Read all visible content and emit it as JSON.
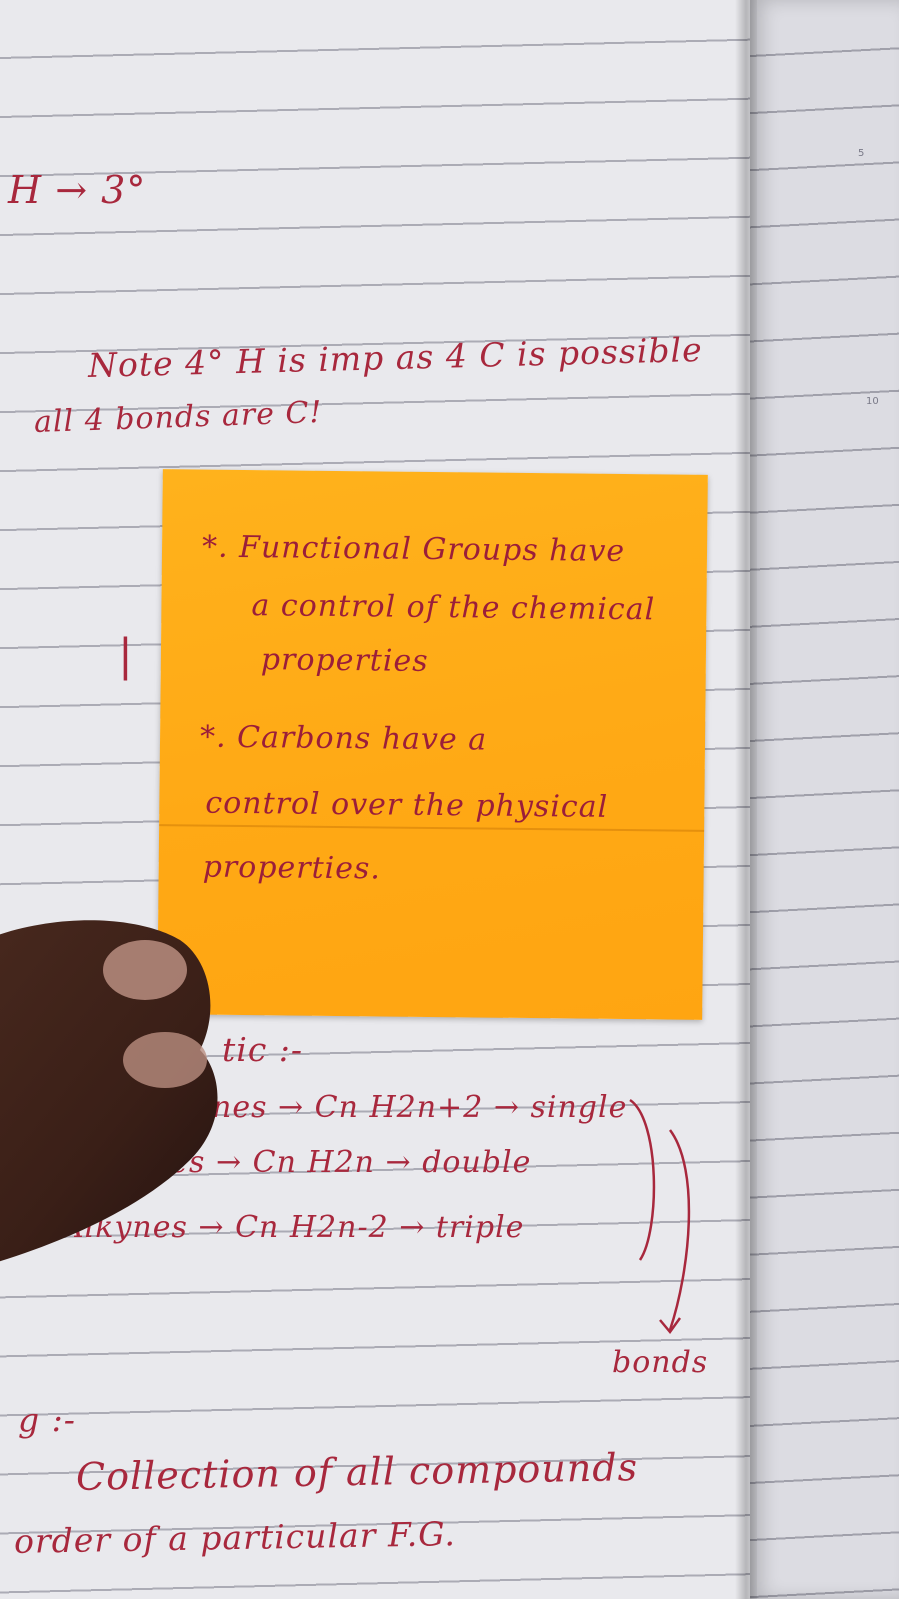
{
  "notebook": {
    "top_fragment": "H → 3°",
    "note_line_1": "Note 4° H is imp as 4 C is possible",
    "note_line_2": "all 4 bonds are C!",
    "margin_mark": "|",
    "page_numbers": [
      "5",
      "10"
    ]
  },
  "sticky_note": {
    "point_1_line_1": "*. Functional Groups have",
    "point_1_line_2": "a control of the chemical",
    "point_1_line_3": "properties",
    "point_2_line_1": "*. Carbons have a",
    "point_2_line_2": "control over the physical",
    "point_2_line_3": "properties."
  },
  "lower_notes": {
    "heading": "tic :-",
    "alkanes": "nes → Cn H2n+2 → single",
    "alkenes": "kenes → Cn H2n → double",
    "alkynes": "Alkynes → Cn H2n-2 → triple",
    "bonds_label": "bonds",
    "eg_label": "g :-",
    "definition_line_1": "Collection of all compounds",
    "definition_line_2": "order of a particular F.G."
  },
  "colors": {
    "ink": "#a8283d",
    "sticky": "#ffa915",
    "paper": "#e9e9ed"
  }
}
